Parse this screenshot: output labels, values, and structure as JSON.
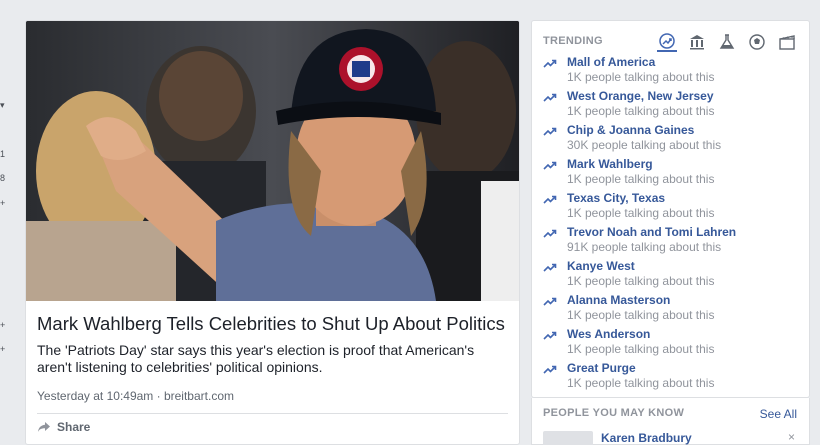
{
  "left_strip": {
    "chevron": "▾",
    "items": [
      "1",
      "8",
      "+",
      "+",
      "+"
    ]
  },
  "post": {
    "image_alt": "Mark Wahlberg pointing, wearing a Patriots cap",
    "headline": "Mark Wahlberg Tells Celebrities to Shut Up About Politics",
    "summary": "The 'Patriots Day' star says this year's election is proof that American's aren't listening to celebrities' political opinions.",
    "meta": "Yesterday at 10:49am · breitbart.com",
    "share_label": "Share"
  },
  "trending": {
    "title": "TRENDING",
    "categories": [
      {
        "icon": "trending-icon",
        "active": true
      },
      {
        "icon": "politics-icon",
        "active": false
      },
      {
        "icon": "science-icon",
        "active": false
      },
      {
        "icon": "sports-icon",
        "active": false
      },
      {
        "icon": "entertainment-icon",
        "active": false
      }
    ],
    "items": [
      {
        "name": "Mall of America",
        "count": "1K people talking about this"
      },
      {
        "name": "West Orange, New Jersey",
        "count": "1K people talking about this"
      },
      {
        "name": "Chip & Joanna Gaines",
        "count": "30K people talking about this"
      },
      {
        "name": "Mark Wahlberg",
        "count": "1K people talking about this"
      },
      {
        "name": "Texas City, Texas",
        "count": "1K people talking about this"
      },
      {
        "name": "Trevor Noah and Tomi Lahren",
        "count": "91K people talking about this"
      },
      {
        "name": "Kanye West",
        "count": "1K people talking about this"
      },
      {
        "name": "Alanna Masterson",
        "count": "1K people talking about this"
      },
      {
        "name": "Wes Anderson",
        "count": "1K people talking about this"
      },
      {
        "name": "Great Purge",
        "count": "1K people talking about this"
      }
    ]
  },
  "people_you_may_know": {
    "title": "PEOPLE YOU MAY KNOW",
    "see_all": "See All",
    "person_name": "Karen Bradbury",
    "close": "×"
  },
  "colors": {
    "link": "#365899",
    "accent": "#4267b2",
    "muted": "#90949c",
    "background": "#e9ebee"
  }
}
